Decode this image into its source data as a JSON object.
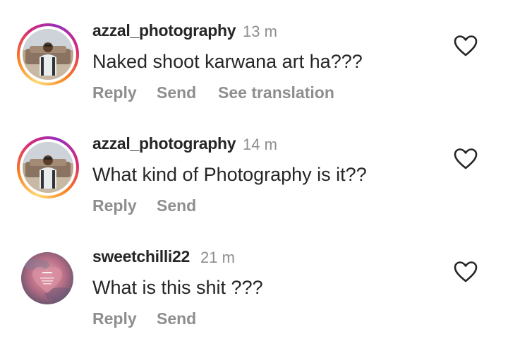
{
  "comments": [
    {
      "username": "azzal_photography",
      "time": "13 m",
      "text": "Naked shoot karwana art ha???",
      "actions": [
        "Reply",
        "Send",
        "See translation"
      ],
      "has_story_ring": true,
      "heart_icon": "heart-outline-icon"
    },
    {
      "username": "azzal_photography",
      "time": "14 m",
      "text": "What kind of Photography is it??",
      "actions": [
        "Reply",
        "Send"
      ],
      "has_story_ring": true,
      "heart_icon": "heart-outline-icon"
    },
    {
      "username": "sweetchilli22",
      "time": "21 m",
      "text": "What is this shit ???",
      "actions": [
        "Reply",
        "Send"
      ],
      "has_story_ring": false,
      "heart_icon": "heart-outline-icon"
    }
  ],
  "colors": {
    "text": "#262626",
    "muted": "#8e8e8e",
    "story_ring": [
      "#feda75",
      "#fa7e1e",
      "#d62976",
      "#962fbf"
    ]
  }
}
